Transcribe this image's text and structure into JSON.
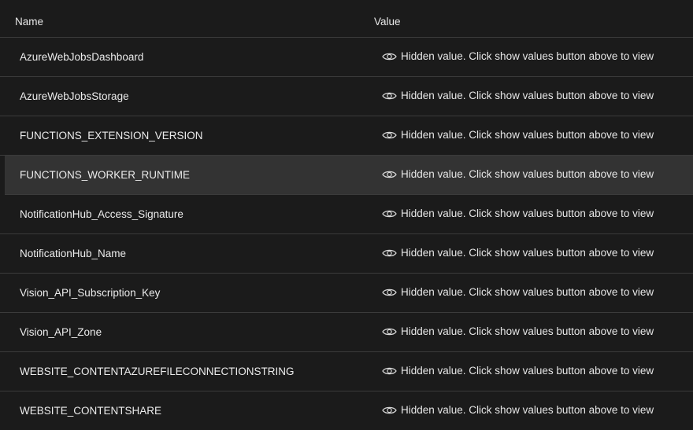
{
  "header": {
    "name_label": "Name",
    "value_label": "Value"
  },
  "rows": [
    {
      "name": "AzureWebJobsDashboard",
      "value": "Hidden value. Click show values button above to view",
      "selected": false
    },
    {
      "name": "AzureWebJobsStorage",
      "value": "Hidden value. Click show values button above to view",
      "selected": false
    },
    {
      "name": "FUNCTIONS_EXTENSION_VERSION",
      "value": "Hidden value. Click show values button above to view",
      "selected": false
    },
    {
      "name": "FUNCTIONS_WORKER_RUNTIME",
      "value": "Hidden value. Click show values button above to view",
      "selected": true
    },
    {
      "name": "NotificationHub_Access_Signature",
      "value": "Hidden value. Click show values button above to view",
      "selected": false
    },
    {
      "name": "NotificationHub_Name",
      "value": "Hidden value. Click show values button above to view",
      "selected": false
    },
    {
      "name": "Vision_API_Subscription_Key",
      "value": "Hidden value. Click show values button above to view",
      "selected": false
    },
    {
      "name": "Vision_API_Zone",
      "value": "Hidden value. Click show values button above to view",
      "selected": false
    },
    {
      "name": "WEBSITE_CONTENTAZUREFILECONNECTIONSTRING",
      "value": "Hidden value. Click show values button above to view",
      "selected": false
    },
    {
      "name": "WEBSITE_CONTENTSHARE",
      "value": "Hidden value. Click show values button above to view",
      "selected": false
    }
  ],
  "icons": {
    "value_icon": "eye-icon"
  },
  "colors": {
    "background": "#1b1b1b",
    "selected_row": "#333333",
    "divider": "#3b3b3b",
    "text": "#e6e6e6"
  }
}
